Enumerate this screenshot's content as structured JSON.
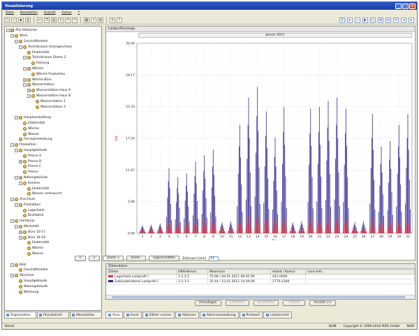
{
  "window": {
    "title": "Visualisierung",
    "controls": [
      "_",
      "□",
      "×"
    ]
  },
  "menu": [
    "Datei",
    "Bearbeiten",
    "Ansicht",
    "Extras",
    "?"
  ],
  "toolbar": {
    "left_icons": [
      "new-icon",
      "open-icon",
      "save-icon",
      "print-icon",
      "cut-icon",
      "copy-icon",
      "paste-icon",
      "delete-icon",
      "undo-icon",
      "redo-icon",
      "grid-icon",
      "export-icon",
      "chart-icon",
      "close-icon",
      "help-icon"
    ],
    "right_icons": [
      "sum-icon",
      "day-icon",
      "week-icon",
      "month-icon",
      "year-icon",
      "zoom-icon",
      "compare-icon",
      "refresh-icon",
      "back-icon",
      "forward-icon"
    ]
  },
  "tree": [
    {
      "label": "Alle Stationen",
      "depth": 0,
      "exp": "-",
      "root": true
    },
    {
      "label": "Werk",
      "depth": 1,
      "exp": "-"
    },
    {
      "label": "Geschäftsstelle",
      "depth": 2,
      "exp": "-"
    },
    {
      "label": "Technikraum Untergeschoss",
      "depth": 3,
      "exp": "-"
    },
    {
      "label": "Elektrizität",
      "depth": 4,
      "exp": ""
    },
    {
      "label": "Technikraum Ebene 2",
      "depth": 4,
      "exp": "-"
    },
    {
      "label": "Heizung",
      "depth": 5,
      "exp": ""
    },
    {
      "label": "Wärme",
      "depth": 4,
      "exp": "-"
    },
    {
      "label": "Wärme Produktion",
      "depth": 5,
      "exp": ""
    },
    {
      "label": "Wärme Büro",
      "depth": 4,
      "exp": "+"
    },
    {
      "label": "Wasserstation",
      "depth": 4,
      "exp": "-"
    },
    {
      "label": "Wasserstation Haus A",
      "depth": 5,
      "exp": "+"
    },
    {
      "label": "Wasserstation Haus B",
      "depth": 5,
      "exp": "-"
    },
    {
      "label": "Wasserstation 1",
      "depth": 6,
      "exp": ""
    },
    {
      "label": "Wasserstation 2",
      "depth": 6,
      "exp": ""
    },
    {
      "label": "",
      "depth": 2,
      "exp": ""
    },
    {
      "label": "Hauptverwaltung",
      "depth": 2,
      "exp": "-"
    },
    {
      "label": "Elektrizität",
      "depth": 3,
      "exp": ""
    },
    {
      "label": "Wärme",
      "depth": 3,
      "exp": ""
    },
    {
      "label": "Wasser",
      "depth": 3,
      "exp": ""
    },
    {
      "label": "Fernwärmeleitung",
      "depth": 2,
      "exp": ""
    },
    {
      "label": "Produktion",
      "depth": 1,
      "exp": "-"
    },
    {
      "label": "Hauptgebäude",
      "depth": 2,
      "exp": "-"
    },
    {
      "label": "Presse A",
      "depth": 3,
      "exp": ""
    },
    {
      "label": "Presse B",
      "depth": 3,
      "exp": "+"
    },
    {
      "label": "Presse C",
      "depth": 3,
      "exp": ""
    },
    {
      "label": "Presse",
      "depth": 3,
      "exp": ""
    },
    {
      "label": "Nebengebäude",
      "depth": 2,
      "exp": "-"
    },
    {
      "label": "Kantine",
      "depth": 3,
      "exp": "-"
    },
    {
      "label": "Elektrizität",
      "depth": 4,
      "exp": ""
    },
    {
      "label": "Wasser verbraucht",
      "depth": 4,
      "exp": ""
    },
    {
      "label": "Anschluss",
      "depth": 1,
      "exp": "-"
    },
    {
      "label": "Produktion",
      "depth": 2,
      "exp": "-"
    },
    {
      "label": "Lagerhalle",
      "depth": 3,
      "exp": ""
    },
    {
      "label": "Brotfabrik",
      "depth": 3,
      "exp": ""
    },
    {
      "label": "Hamburg",
      "depth": 1,
      "exp": "-"
    },
    {
      "label": "Werkstatt",
      "depth": 2,
      "exp": "-"
    },
    {
      "label": "Büro 10-17",
      "depth": 3,
      "exp": "+"
    },
    {
      "label": "Büro 18-19",
      "depth": 3,
      "exp": "-"
    },
    {
      "label": "Elektrizität",
      "depth": 4,
      "exp": ""
    },
    {
      "label": "Wärme",
      "depth": 4,
      "exp": ""
    },
    {
      "label": "Wasser",
      "depth": 4,
      "exp": ""
    },
    {
      "label": "",
      "depth": 1,
      "exp": ""
    },
    {
      "label": "Köln",
      "depth": 1,
      "exp": "-"
    },
    {
      "label": "Geschäftsstelle",
      "depth": 2,
      "exp": ""
    },
    {
      "label": "München",
      "depth": 1,
      "exp": "-"
    },
    {
      "label": "Hauptgebäude",
      "depth": 2,
      "exp": ""
    },
    {
      "label": "Nebengebäude",
      "depth": 2,
      "exp": ""
    },
    {
      "label": "Wohnung",
      "depth": 2,
      "exp": ""
    }
  ],
  "left_tabs": [
    "Organisation",
    "Physikalisch",
    "Messstellen"
  ],
  "panel": {
    "title": "Lastprofilanzeige",
    "month": "Januar 2011"
  },
  "chart_data": {
    "type": "bar",
    "xlabel": "Tag",
    "ylabel": "kW",
    "x": [
      1,
      2,
      3,
      4,
      5,
      6,
      7,
      8,
      9,
      10,
      11,
      12,
      13,
      14,
      15,
      16,
      17,
      18,
      19,
      20,
      21,
      22,
      23,
      24,
      25,
      26,
      27,
      28,
      29,
      30,
      31
    ],
    "ylim": [
      0,
      35.04
    ],
    "yticks": [
      "0.00",
      "5.84",
      "11.67",
      "17.50",
      "23.33",
      "29.17",
      "35.04"
    ],
    "grid": true,
    "series": [
      {
        "color": "#2a1f8f",
        "values": [
          1.5,
          1.6,
          1.8,
          12.0,
          10.4,
          11.0,
          13.2,
          14.4,
          15.4,
          2.0,
          2.2,
          20.0,
          25.0,
          27.0,
          22.5,
          17.6,
          23.3,
          2.0,
          2.2,
          23.0,
          23.3,
          24.4,
          25.0,
          23.0,
          2.0,
          2.2,
          22.0,
          16.0,
          17.0,
          20.0,
          22.0
        ]
      },
      {
        "color": "#d8353f",
        "values": [
          0.8,
          0.9,
          1.0,
          2.2,
          2.0,
          2.1,
          2.3,
          2.5,
          2.6,
          1.0,
          1.0,
          2.4,
          3.2,
          3.4,
          2.9,
          2.5,
          2.8,
          1.0,
          1.0,
          2.6,
          2.7,
          2.8,
          2.9,
          2.7,
          1.0,
          1.0,
          2.5,
          2.2,
          2.3,
          2.4,
          2.6
        ]
      }
    ]
  },
  "controls": {
    "prev_label": "<",
    "next_label": ">",
    "zoom_in_label": "Zoom +",
    "zoom_out_label": "Zoom -",
    "properties_label": "Eigenschaften",
    "period_label": "Zeitraum [min]",
    "period_value": "15"
  },
  "details": {
    "title": "Zählerdaten",
    "columns": [
      "Zähler",
      "OBIS-Kennz.",
      "Maximum",
      "Arbeit / Kumul.",
      "Cons-Info"
    ],
    "rows": [
      {
        "swatch": "#d8353f",
        "cells": [
          "Lagerhalle Lastprofil /",
          "1-1:1.5",
          "75.96 / 04.01.2011 08:45:00",
          "441.0000",
          ""
        ]
      },
      {
        "swatch": "#2a1f8f",
        "cells": [
          "Gebäudehalterei Lastprofil /",
          "1-1:1.5",
          "35.44 / 12.01.2011 14:30:00",
          "2770.2300",
          ""
        ]
      }
    ]
  },
  "actions": [
    {
      "label": "Hinzufügen",
      "enabled": true
    },
    {
      "label": "Entfernen",
      "enabled": false
    },
    {
      "label": "Bearbeiten",
      "enabled": false
    },
    {
      "label": "Vollbild",
      "enabled": false
    },
    {
      "label": "Ansicht >>",
      "enabled": true
    }
  ],
  "bottom_tabs": [
    "Visio",
    "Excel",
    "Zähler suchen",
    "Aktionen",
    "Aktionsverwaltung",
    "Protokoll",
    "Lasteinsicht"
  ],
  "status": {
    "left": "Bereit",
    "right": [
      "NUM",
      "Copyright © 1999-2010 MZR GmbH",
      "NUM"
    ]
  }
}
